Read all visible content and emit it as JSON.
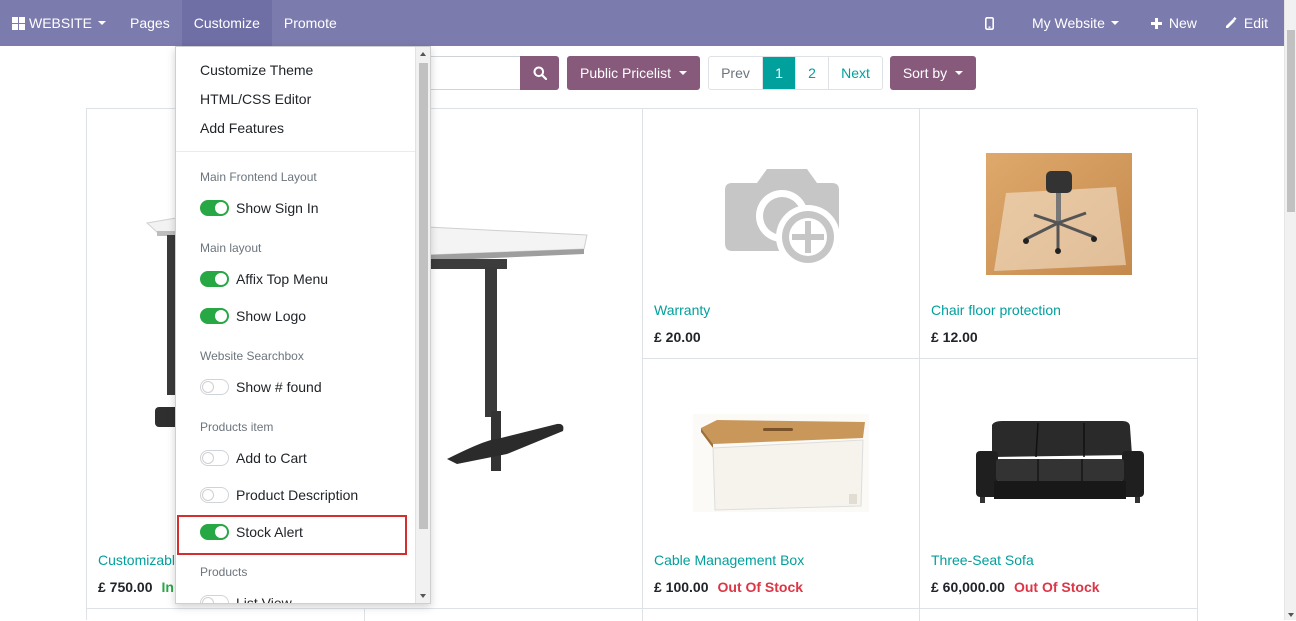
{
  "navbar": {
    "brand": "WEBSITE",
    "pages": "Pages",
    "customize": "Customize",
    "promote": "Promote",
    "my_website": "My Website",
    "new": "New",
    "edit": "Edit",
    "color": "#7c7bad"
  },
  "toolbar": {
    "search_placeholder": "",
    "pricelist": "Public Pricelist",
    "pager": [
      "Prev",
      "1",
      "2",
      "Next"
    ],
    "sort": "Sort by",
    "accent": "#875a7b"
  },
  "products": [
    {
      "name": "Customizabl",
      "price": "£ 750.00",
      "stock": "In"
    },
    {
      "name": "Warranty",
      "price": "£ 20.00",
      "stock": ""
    },
    {
      "name": "Chair floor protection",
      "price": "£ 12.00",
      "stock": ""
    },
    {
      "name": "Cable Management Box",
      "price": "£ 100.00",
      "stock": "Out Of Stock"
    },
    {
      "name": "Three-Seat Sofa",
      "price": "£ 60,000.00",
      "stock": "Out Of Stock"
    }
  ],
  "customize_menu": {
    "links": [
      "Customize Theme",
      "HTML/CSS Editor",
      "Add Features"
    ],
    "sections": [
      {
        "header": "Main Frontend Layout",
        "toggles": [
          {
            "label": "Show Sign In",
            "on": true
          }
        ]
      },
      {
        "header": "Main layout",
        "toggles": [
          {
            "label": "Affix Top Menu",
            "on": true
          },
          {
            "label": "Show Logo",
            "on": true
          }
        ]
      },
      {
        "header": "Website Searchbox",
        "toggles": [
          {
            "label": "Show # found",
            "on": false
          }
        ]
      },
      {
        "header": "Products item",
        "toggles": [
          {
            "label": "Add to Cart",
            "on": false
          },
          {
            "label": "Product Description",
            "on": false
          },
          {
            "label": "Stock Alert",
            "on": true
          }
        ]
      },
      {
        "header": "Products",
        "toggles": [
          {
            "label": "List View",
            "on": false
          }
        ]
      }
    ]
  },
  "colors": {
    "teal": "#00a09d",
    "danger": "#dc3545",
    "success": "#28a745",
    "highlight": "#d32f2f"
  }
}
